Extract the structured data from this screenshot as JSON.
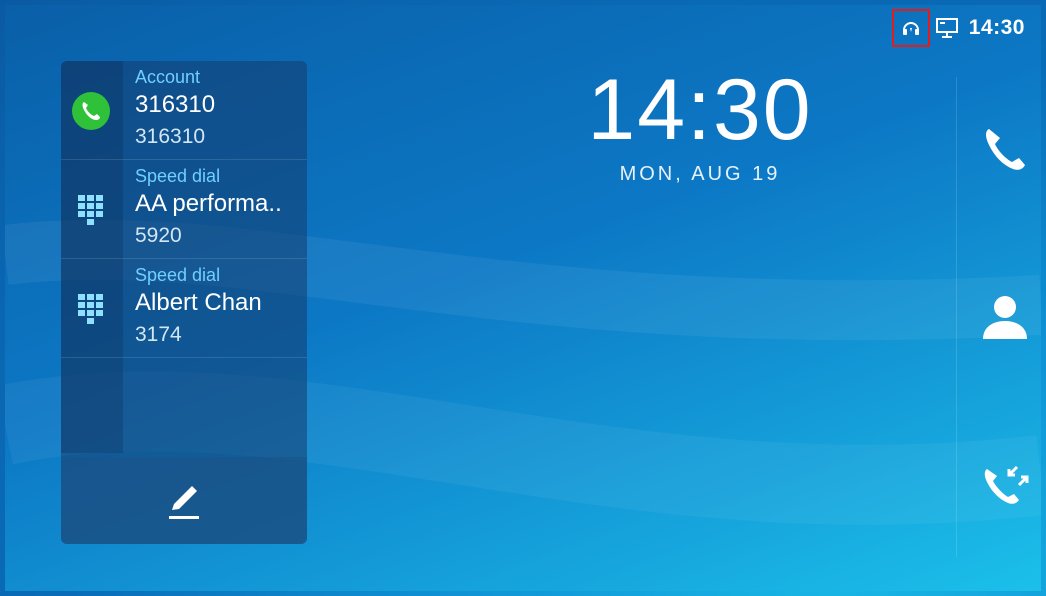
{
  "status_bar": {
    "time": "14:30",
    "icons": [
      "headset-icon",
      "network-icon"
    ]
  },
  "clock": {
    "time": "14:30",
    "date": "MON, AUG 19"
  },
  "accounts": [
    {
      "type": "account",
      "icon": "phone-icon",
      "label": "Account",
      "name": "316310",
      "number": "316310"
    },
    {
      "type": "speed-dial",
      "icon": "keypad-icon",
      "label": "Speed dial",
      "name": "AA performa..",
      "number": "5920"
    },
    {
      "type": "speed-dial",
      "icon": "keypad-icon",
      "label": "Speed dial",
      "name": "Albert Chan",
      "number": "3174"
    }
  ],
  "sidebar": {
    "buttons": [
      "dialer-icon",
      "contacts-icon",
      "call-history-icon"
    ]
  },
  "colors": {
    "accent_label": "#6fd0ff",
    "account_green": "#2fc13a",
    "highlight_red": "#e01e1e"
  }
}
